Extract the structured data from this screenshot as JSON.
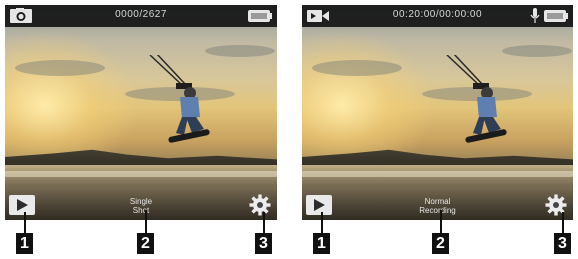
{
  "screens": [
    {
      "mode_icon": "camera-icon",
      "status_text": "0000/2627",
      "show_mic": false,
      "battery_icon": "battery-icon",
      "play_icon": "play-icon",
      "mode_label_line1": "Single",
      "mode_label_line2": "Shot",
      "settings_icon": "gear-icon"
    },
    {
      "mode_icon": "video-camera-icon",
      "status_text": "00:20:00/00:00:00",
      "show_mic": true,
      "battery_icon": "battery-icon",
      "play_icon": "play-icon",
      "mode_label_line1": "Normal",
      "mode_label_line2": "Recording",
      "settings_icon": "gear-icon"
    }
  ],
  "callouts": [
    "1",
    "2",
    "3",
    "1",
    "2",
    "3"
  ],
  "colors": {
    "status_bar": "#141414",
    "status_text": "#d7d7d7",
    "callout_bg": "#111111",
    "callout_text": "#ffffff"
  }
}
